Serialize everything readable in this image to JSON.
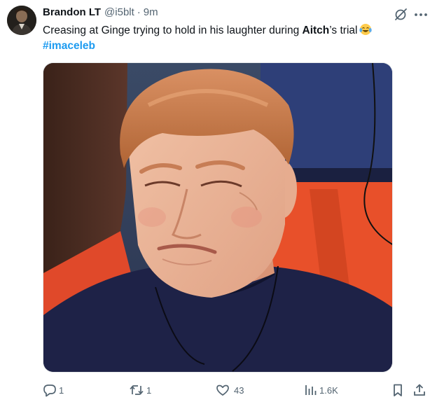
{
  "tweet": {
    "author": {
      "name": "Brandon LT",
      "handle": "@i5blt",
      "separator": "·",
      "time": "9m"
    },
    "text_before": "Creasing at Ginge trying to hold in his laughter during ",
    "text_bold": "Aitch",
    "text_after": "’s trial",
    "emoji": "tears-of-joy-emoji",
    "hashtag": "#imaceleb"
  },
  "actions": {
    "replies": "1",
    "reposts": "1",
    "likes": "43",
    "views": "1.6K"
  },
  "icons": {
    "grok": "grok-icon",
    "more": "more-dots-icon",
    "reply": "reply-icon",
    "repost": "repost-icon",
    "like": "heart-icon",
    "views": "views-chart-icon",
    "bookmark": "bookmark-icon",
    "share": "share-icon"
  },
  "colors": {
    "text": "#0f1419",
    "secondary": "#536471",
    "accent": "#1d9bf0"
  }
}
